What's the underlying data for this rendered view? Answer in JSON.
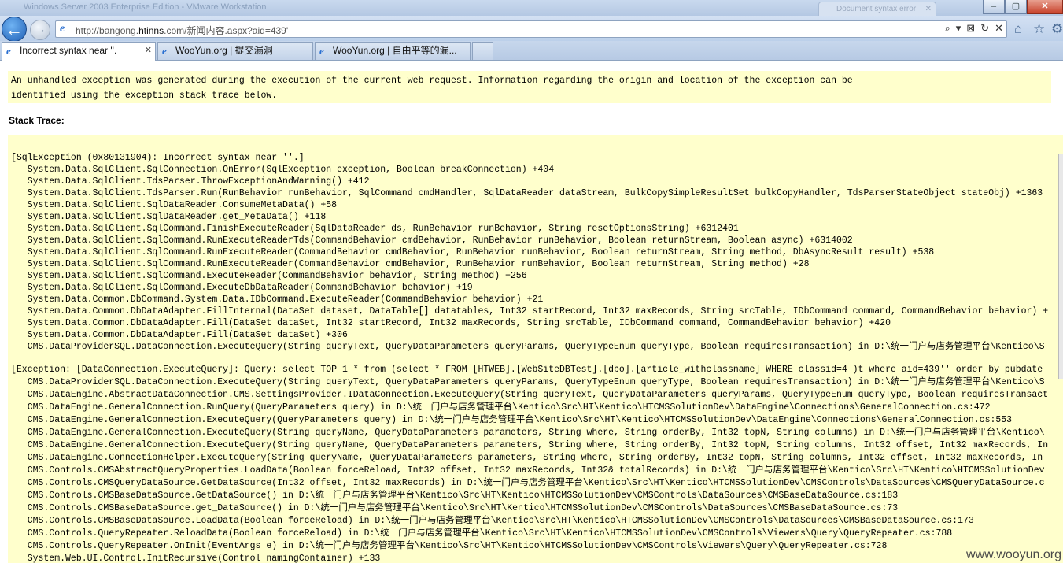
{
  "browser": {
    "window_title_ghost": "Windows Server 2003 Enterprise Edition - VMware Workstation",
    "ghost_tab": "Document syntax error",
    "url_prefix": "http://bangong.",
    "url_host": "htinns",
    "url_suffix": ".com/新闻内容.aspx?aid=439'",
    "tabs": [
      {
        "label": "Incorrect syntax near ''.",
        "active": true
      },
      {
        "label": "WooYun.org | 提交漏洞",
        "active": false
      },
      {
        "label": "WooYun.org | 自由平等的漏...",
        "active": false
      }
    ]
  },
  "page": {
    "message_line1": "An unhandled exception was generated during the execution of the current web request. Information regarding the origin and location of the exception can be",
    "message_line2": "identified using the exception stack trace below.",
    "stack_trace_title": "Stack Trace:",
    "trace1": [
      "[SqlException (0x80131904): Incorrect syntax near ''.]",
      "   System.Data.SqlClient.SqlConnection.OnError(SqlException exception, Boolean breakConnection) +404",
      "   System.Data.SqlClient.TdsParser.ThrowExceptionAndWarning() +412",
      "   System.Data.SqlClient.TdsParser.Run(RunBehavior runBehavior, SqlCommand cmdHandler, SqlDataReader dataStream, BulkCopySimpleResultSet bulkCopyHandler, TdsParserStateObject stateObj) +1363",
      "   System.Data.SqlClient.SqlDataReader.ConsumeMetaData() +58",
      "   System.Data.SqlClient.SqlDataReader.get_MetaData() +118",
      "   System.Data.SqlClient.SqlCommand.FinishExecuteReader(SqlDataReader ds, RunBehavior runBehavior, String resetOptionsString) +6312401",
      "   System.Data.SqlClient.SqlCommand.RunExecuteReaderTds(CommandBehavior cmdBehavior, RunBehavior runBehavior, Boolean returnStream, Boolean async) +6314002",
      "   System.Data.SqlClient.SqlCommand.RunExecuteReader(CommandBehavior cmdBehavior, RunBehavior runBehavior, Boolean returnStream, String method, DbAsyncResult result) +538",
      "   System.Data.SqlClient.SqlCommand.RunExecuteReader(CommandBehavior cmdBehavior, RunBehavior runBehavior, Boolean returnStream, String method) +28",
      "   System.Data.SqlClient.SqlCommand.ExecuteReader(CommandBehavior behavior, String method) +256",
      "   System.Data.SqlClient.SqlCommand.ExecuteDbDataReader(CommandBehavior behavior) +19",
      "   System.Data.Common.DbCommand.System.Data.IDbCommand.ExecuteReader(CommandBehavior behavior) +21",
      "   System.Data.Common.DbDataAdapter.FillInternal(DataSet dataset, DataTable[] datatables, Int32 startRecord, Int32 maxRecords, String srcTable, IDbCommand command, CommandBehavior behavior) +",
      "   System.Data.Common.DbDataAdapter.Fill(DataSet dataSet, Int32 startRecord, Int32 maxRecords, String srcTable, IDbCommand command, CommandBehavior behavior) +420",
      "   System.Data.Common.DbDataAdapter.Fill(DataSet dataSet) +306",
      "   CMS.DataProviderSQL.DataConnection.ExecuteQuery(String queryText, QueryDataParameters queryParams, QueryTypeEnum queryType, Boolean requiresTransaction) in D:\\统一门户与店务管理平台\\Kentico\\S"
    ],
    "trace2": [
      "[Exception: [DataConnection.ExecuteQuery]: Query: select TOP 1 * from (select * FROM [HTWEB].[WebSiteDBTest].[dbo].[article_withclassname] WHERE classid=4 )t where aid=439'' order by pubdate",
      "   CMS.DataProviderSQL.DataConnection.ExecuteQuery(String queryText, QueryDataParameters queryParams, QueryTypeEnum queryType, Boolean requiresTransaction) in D:\\统一门户与店务管理平台\\Kentico\\S",
      "   CMS.DataEngine.AbstractDataConnection.CMS.SettingsProvider.IDataConnection.ExecuteQuery(String queryText, QueryDataParameters queryParams, QueryTypeEnum queryType, Boolean requiresTransact",
      "   CMS.DataEngine.GeneralConnection.RunQuery(QueryParameters query) in D:\\统一门户与店务管理平台\\Kentico\\Src\\HT\\Kentico\\HTCMSSolutionDev\\DataEngine\\Connections\\GeneralConnection.cs:472",
      "   CMS.DataEngine.GeneralConnection.ExecuteQuery(QueryParameters query) in D:\\统一门户与店务管理平台\\Kentico\\Src\\HT\\Kentico\\HTCMSSolutionDev\\DataEngine\\Connections\\GeneralConnection.cs:553",
      "   CMS.DataEngine.GeneralConnection.ExecuteQuery(String queryName, QueryDataParameters parameters, String where, String orderBy, Int32 topN, String columns) in D:\\统一门户与店务管理平台\\Kentico\\",
      "   CMS.DataEngine.GeneralConnection.ExecuteQuery(String queryName, QueryDataParameters parameters, String where, String orderBy, Int32 topN, String columns, Int32 offset, Int32 maxRecords, In",
      "   CMS.DataEngine.ConnectionHelper.ExecuteQuery(String queryName, QueryDataParameters parameters, String where, String orderBy, Int32 topN, String columns, Int32 offset, Int32 maxRecords, In",
      "   CMS.Controls.CMSAbstractQueryProperties.LoadData(Boolean forceReload, Int32 offset, Int32 maxRecords, Int32& totalRecords) in D:\\统一门户与店务管理平台\\Kentico\\Src\\HT\\Kentico\\HTCMSSolutionDev",
      "   CMS.Controls.CMSQueryDataSource.GetDataSource(Int32 offset, Int32 maxRecords) in D:\\统一门户与店务管理平台\\Kentico\\Src\\HT\\Kentico\\HTCMSSolutionDev\\CMSControls\\DataSources\\CMSQueryDataSource.c",
      "   CMS.Controls.CMSBaseDataSource.GetDataSource() in D:\\统一门户与店务管理平台\\Kentico\\Src\\HT\\Kentico\\HTCMSSolutionDev\\CMSControls\\DataSources\\CMSBaseDataSource.cs:183",
      "   CMS.Controls.CMSBaseDataSource.get_DataSource() in D:\\统一门户与店务管理平台\\Kentico\\Src\\HT\\Kentico\\HTCMSSolutionDev\\CMSControls\\DataSources\\CMSBaseDataSource.cs:73",
      "   CMS.Controls.CMSBaseDataSource.LoadData(Boolean forceReload) in D:\\统一门户与店务管理平台\\Kentico\\Src\\HT\\Kentico\\HTCMSSolutionDev\\CMSControls\\DataSources\\CMSBaseDataSource.cs:173",
      "   CMS.Controls.QueryRepeater.ReloadData(Boolean forceReload) in D:\\统一门户与店务管理平台\\Kentico\\Src\\HT\\Kentico\\HTCMSSolutionDev\\CMSControls\\Viewers\\Query\\QueryRepeater.cs:788",
      "   CMS.Controls.QueryRepeater.OnInit(EventArgs e) in D:\\统一门户与店务管理平台\\Kentico\\Src\\HT\\Kentico\\HTCMSSolutionDev\\CMSControls\\Viewers\\Query\\QueryRepeater.cs:728",
      "   System.Web.UI.Control.InitRecursive(Control namingContainer) +133"
    ],
    "watermark": "www.wooyun.org"
  }
}
